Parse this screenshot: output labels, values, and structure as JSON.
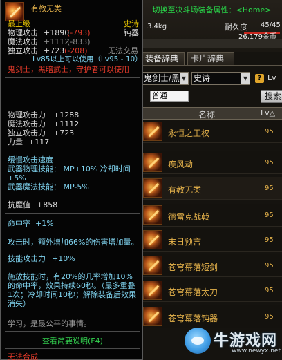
{
  "tooltip": {
    "item_name": "有教无类",
    "grade_label": "最上级",
    "rarity": "史诗",
    "phys_attack_label": "物理攻击",
    "phys_attack_value": "+1890",
    "phys_attack_diff": "(-793)",
    "magic_attack_label": "魔法攻击",
    "magic_attack_value": "+1112",
    "magic_attack_diff": "(-833)",
    "indep_attack_label": "独立攻击",
    "indep_attack_value": "+723",
    "indep_attack_diff": "(-208)",
    "type": "钝器",
    "weight": "3.4kg",
    "trade": "无法交易",
    "level_req": "Lv85以上可以使用（Lv95 - 10）",
    "class_req": "鬼剑士，黑暗武士，守护者可以使用",
    "stats": [
      {
        "label": "物理攻击力",
        "value": "+1288"
      },
      {
        "label": "魔法攻击力",
        "value": "+1112"
      },
      {
        "label": "独立攻击力",
        "value": "+723"
      },
      {
        "label": "力量",
        "value": "+117"
      }
    ],
    "speed_line": "缓慢攻击速度",
    "skill_phys": "武器物理技能： MP+10% 冷却时间+5%",
    "skill_magic": "武器魔法技能： MP-5%",
    "ailment_label": "抗魔值",
    "ailment_value": "+858",
    "hit_label": "命中率",
    "hit_value": "+1%",
    "effect1": "攻击时，额外增加66%的伤害增加量。",
    "effect2_label": "技能攻击力",
    "effect2_value": "+10%",
    "effect3": "施放技能时，有20%的几率增加10%的命中率，效果持续60秒。（最多重叠1次；冷却时间10秒；解除装备后效果消失）",
    "flavor": "学习，是最公平的事情。",
    "view_desc": "查看简要说明(F4)",
    "cannot_synth": "无法合成"
  },
  "dict": {
    "title": "切换至决斗场装备属性：<Home>",
    "durability_label": "耐久度",
    "durability_value": "45/45",
    "durability_fraction": 1.0,
    "gold": "26,179金币",
    "tabs": [
      "装备辞典",
      "卡片辞典"
    ],
    "job_select": "鬼剑士/黑",
    "grade_select": "史诗",
    "help_icon": "?",
    "lv_label": "Lv",
    "filter_value": "普通",
    "search_label": "搜索",
    "col_name": "名称",
    "col_lv": "Lv△",
    "items": [
      {
        "name": "永恒之王权",
        "lv": "95"
      },
      {
        "name": "疾风劫",
        "lv": "95"
      },
      {
        "name": "有教无类",
        "lv": "95"
      },
      {
        "name": "德雷克战戟",
        "lv": "95"
      },
      {
        "name": "末日预言",
        "lv": "95"
      },
      {
        "name": "苍穹幕落短剑",
        "lv": "95"
      },
      {
        "name": "苍穹幕落太刀",
        "lv": "95"
      },
      {
        "name": "苍穹幕落钝器",
        "lv": "95"
      }
    ]
  },
  "watermark": {
    "text": "牛游戏网",
    "url": "www.newyx.net"
  }
}
